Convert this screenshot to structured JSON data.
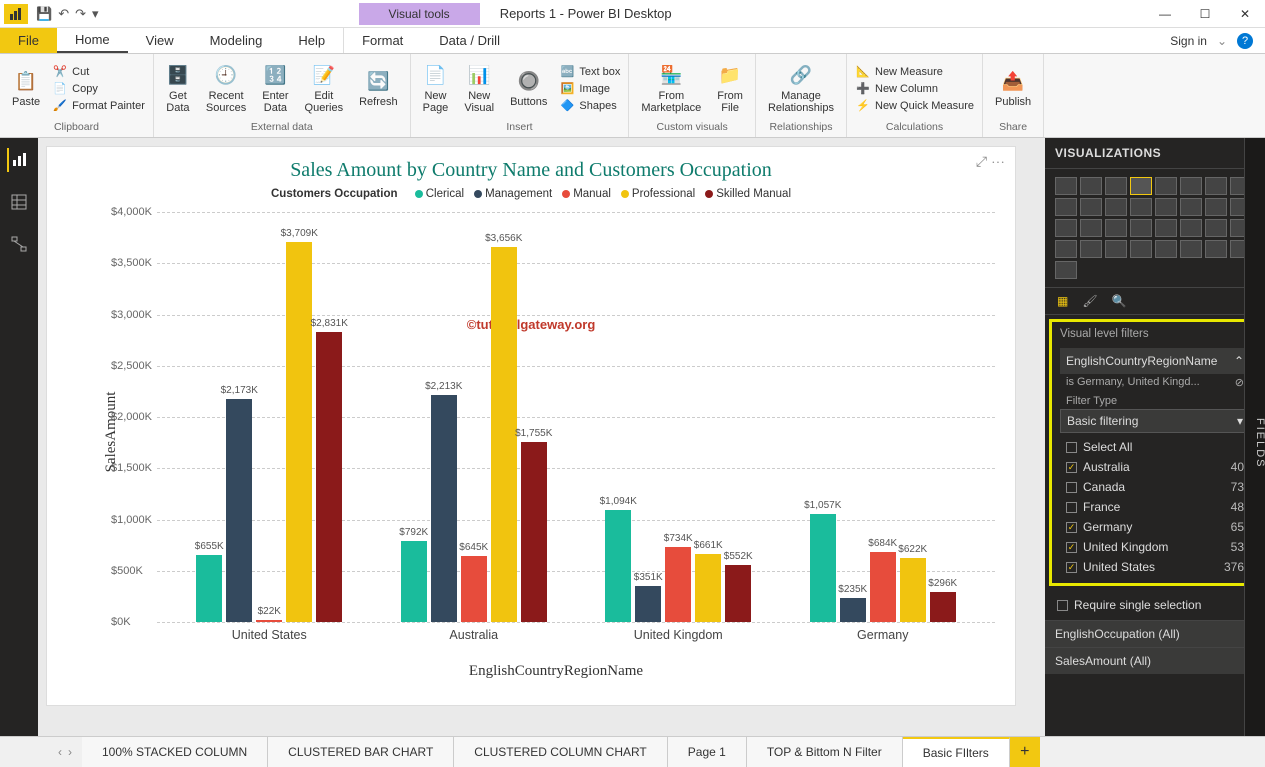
{
  "window": {
    "title": "Reports 1 - Power BI Desktop",
    "visual_tools": "Visual tools",
    "signin": "Sign in"
  },
  "menu": {
    "file": "File",
    "home": "Home",
    "view": "View",
    "modeling": "Modeling",
    "help": "Help",
    "format": "Format",
    "datadrill": "Data / Drill"
  },
  "ribbon": {
    "paste": "Paste",
    "cut": "Cut",
    "copy": "Copy",
    "format_painter": "Format Painter",
    "clipboard": "Clipboard",
    "get_data": "Get\nData",
    "recent_sources": "Recent\nSources",
    "enter_data": "Enter\nData",
    "edit_queries": "Edit\nQueries",
    "refresh": "Refresh",
    "external_data": "External data",
    "new_page": "New\nPage",
    "new_visual": "New\nVisual",
    "buttons": "Buttons",
    "text_box": "Text box",
    "image": "Image",
    "shapes": "Shapes",
    "insert": "Insert",
    "from_marketplace": "From\nMarketplace",
    "from_file": "From\nFile",
    "custom_visuals": "Custom visuals",
    "manage_relationships": "Manage\nRelationships",
    "relationships": "Relationships",
    "new_measure": "New Measure",
    "new_column": "New Column",
    "new_quick": "New Quick Measure",
    "calculations": "Calculations",
    "publish": "Publish",
    "share": "Share"
  },
  "viz_panel": {
    "title": "VISUALIZATIONS",
    "filters_title": "Visual level filters",
    "field_name": "EnglishCountryRegionName",
    "field_summary": "is Germany, United Kingd...",
    "filter_type_label": "Filter Type",
    "filter_type": "Basic filtering",
    "select_all": "Select All",
    "require_single": "Require single selection",
    "other_field1": "EnglishOccupation (All)",
    "other_field2": "SalesAmount (All)",
    "options": [
      {
        "label": "Australia",
        "count": 40,
        "checked": true
      },
      {
        "label": "Canada",
        "count": 73,
        "checked": false
      },
      {
        "label": "France",
        "count": 48,
        "checked": false
      },
      {
        "label": "Germany",
        "count": 65,
        "checked": true
      },
      {
        "label": "United Kingdom",
        "count": 53,
        "checked": true
      },
      {
        "label": "United States",
        "count": 376,
        "checked": true
      }
    ]
  },
  "fields_tab": "FIELDS",
  "page_tabs": {
    "t1": "100% STACKED COLUMN",
    "t2": "CLUSTERED BAR CHART",
    "t3": "CLUSTERED COLUMN CHART",
    "t4": "Page 1",
    "t5": "TOP & Bittom N Filter",
    "t6": "Basic FIlters"
  },
  "chart_data": {
    "type": "bar",
    "title": "Sales Amount by Country Name and Customers Occupation",
    "legend_title": "Customers Occupation",
    "watermark": "©tutorialgateway.org",
    "xlabel": "EnglishCountryRegionName",
    "ylabel": "SalesAmount",
    "ylim": [
      0,
      4000
    ],
    "yticks": [
      "$0K",
      "$500K",
      "$1,000K",
      "$1,500K",
      "$2,000K",
      "$2,500K",
      "$3,000K",
      "$3,500K",
      "$4,000K"
    ],
    "categories": [
      "United States",
      "Australia",
      "United Kingdom",
      "Germany"
    ],
    "series": [
      {
        "name": "Clerical",
        "color": "#1abc9c",
        "values": [
          655,
          792,
          1094,
          1057
        ],
        "labels": [
          "$655K",
          "$792K",
          "$1,094K",
          "$1,057K"
        ]
      },
      {
        "name": "Management",
        "color": "#34495e",
        "values": [
          2173,
          2213,
          351,
          235
        ],
        "labels": [
          "$2,173K",
          "$2,213K",
          "$351K",
          "$235K"
        ]
      },
      {
        "name": "Manual",
        "color": "#e74c3c",
        "values": [
          22,
          645,
          734,
          684
        ],
        "labels": [
          "$22K",
          "$645K",
          "$734K",
          "$684K"
        ]
      },
      {
        "name": "Professional",
        "color": "#f1c40f",
        "values": [
          3709,
          3656,
          661,
          622
        ],
        "labels": [
          "$3,709K",
          "$3,656K",
          "$661K",
          "$622K"
        ]
      },
      {
        "name": "Skilled Manual",
        "color": "#8b1a1a",
        "values": [
          2831,
          1755,
          552,
          296
        ],
        "labels": [
          "$2,831K",
          "$1,755K",
          "$552K",
          "$296K"
        ]
      }
    ]
  }
}
